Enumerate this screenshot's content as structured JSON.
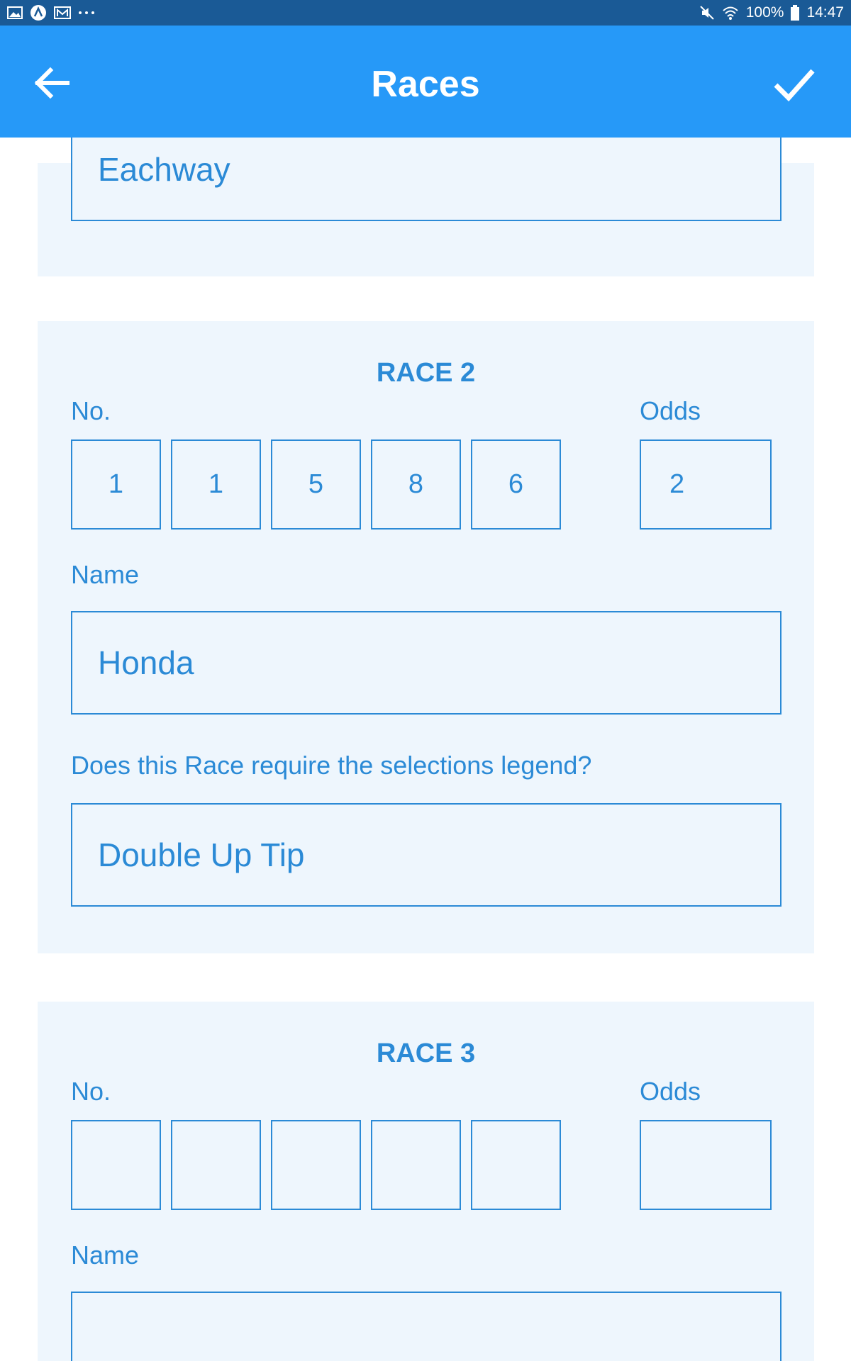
{
  "status_bar": {
    "battery": "100%",
    "time": "14:47",
    "left_icons": [
      "gallery-icon",
      "app-icon",
      "mail-icon",
      "more-icon"
    ],
    "right_icons": [
      "mute-icon",
      "wifi-icon",
      "battery-icon"
    ]
  },
  "app_bar": {
    "title": "Races",
    "back_icon": "arrow-left-icon",
    "confirm_icon": "check-icon",
    "color": "#2699f8"
  },
  "previous_card": {
    "select_value": "Eachway"
  },
  "race2": {
    "title": "RACE 2",
    "no_label": "No.",
    "odds_label": "Odds",
    "digits": [
      "1",
      "1",
      "5",
      "8",
      "6"
    ],
    "odds": "2",
    "name_label": "Name",
    "name_value": "Honda",
    "legend_question": "Does this Race require the selections legend?",
    "legend_value": "Double Up Tip"
  },
  "race3": {
    "title": "RACE 3",
    "no_label": "No.",
    "odds_label": "Odds",
    "digits": [
      "",
      "",
      "",
      "",
      ""
    ],
    "odds": "",
    "name_label": "Name",
    "name_value": ""
  },
  "colors": {
    "accent": "#2b8ad6",
    "card_bg": "#eef6fd",
    "status_bar": "#1a5a96"
  }
}
